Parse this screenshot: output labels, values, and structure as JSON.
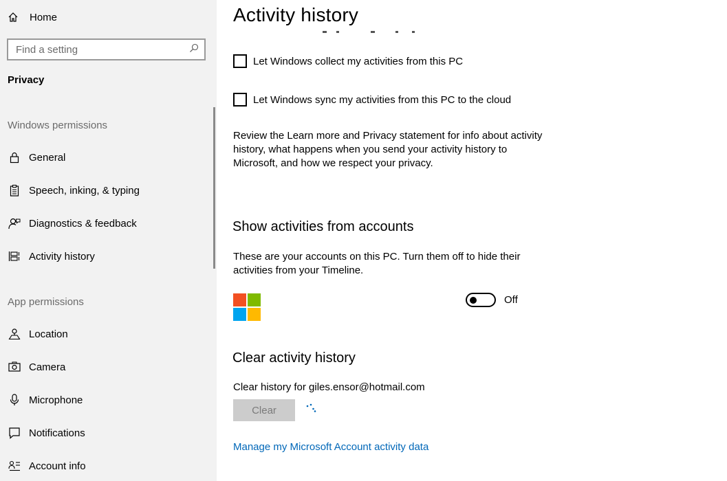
{
  "sidebar": {
    "home_label": "Home",
    "search_placeholder": "Find a setting",
    "section_label": "Privacy",
    "windows_permissions": {
      "title": "Windows permissions",
      "items": [
        {
          "label": "General",
          "icon": "lock-icon"
        },
        {
          "label": "Speech, inking, & typing",
          "icon": "clipboard-icon"
        },
        {
          "label": "Diagnostics & feedback",
          "icon": "person-feedback-icon"
        },
        {
          "label": "Activity history",
          "icon": "timeline-icon"
        }
      ]
    },
    "app_permissions": {
      "title": "App permissions",
      "items": [
        {
          "label": "Location",
          "icon": "location-icon"
        },
        {
          "label": "Camera",
          "icon": "camera-icon"
        },
        {
          "label": "Microphone",
          "icon": "microphone-icon"
        },
        {
          "label": "Notifications",
          "icon": "notification-icon"
        },
        {
          "label": "Account info",
          "icon": "account-info-icon"
        }
      ]
    }
  },
  "main": {
    "title": "Activity history",
    "checkboxes": [
      {
        "label": "Let Windows collect my activities from this PC",
        "checked": false
      },
      {
        "label": "Let Windows sync my activities from this PC to the cloud",
        "checked": false
      }
    ],
    "review_text": "Review the Learn more and Privacy statement for info about activity history, what happens when you send your activity history to Microsoft, and how we respect your privacy.",
    "accounts_section": {
      "title": "Show activities from accounts",
      "description": "These are your accounts on this PC. Turn them off to hide their activities from your Timeline.",
      "toggle_state": "Off",
      "logo_colors": [
        "#f25022",
        "#7fba00",
        "#00a4ef",
        "#ffb900"
      ]
    },
    "clear_section": {
      "title": "Clear activity history",
      "description": "Clear history for giles.ensor@hotmail.com",
      "button_label": "Clear"
    },
    "manage_link": "Manage my Microsoft Account activity data"
  },
  "colors": {
    "sidebar_bg": "#f2f2f2",
    "link": "#0067b8",
    "disabled_button": "#cccccc"
  }
}
